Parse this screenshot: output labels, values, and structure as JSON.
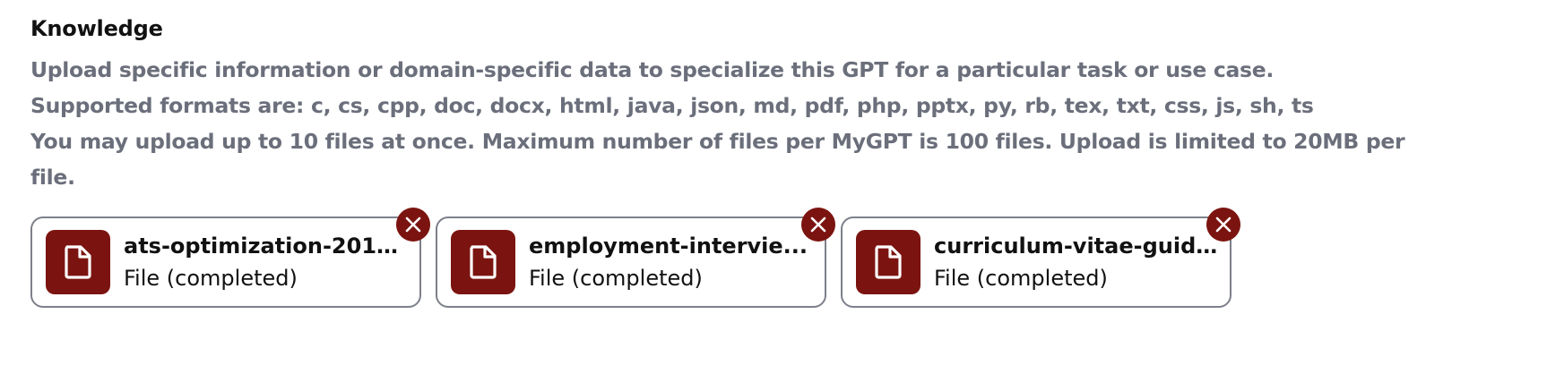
{
  "knowledge": {
    "title": "Knowledge",
    "description_lines": [
      "Upload specific information or domain-specific data to specialize this GPT for a particular task or use case.",
      "Supported formats are: c, cs, cpp, doc, docx, html, java, json, md, pdf, php, pptx, py, rb, tex, txt, css, js, sh, ts",
      "You may upload up to 10 files at once. Maximum number of files per MyGPT is 100 files. Upload is limited to 20MB per file."
    ],
    "files": [
      {
        "name": "ats-optimization-2015....",
        "status": "File (completed)",
        "icon": "document-icon",
        "remove_icon": "close-icon"
      },
      {
        "name": "employment-intervie...",
        "status": "File (completed)",
        "icon": "document-icon",
        "remove_icon": "close-icon"
      },
      {
        "name": "curriculum-vitae-guid...",
        "status": "File (completed)",
        "icon": "document-icon",
        "remove_icon": "close-icon"
      }
    ]
  },
  "colors": {
    "accent": "#7b1410",
    "muted_text": "#6b6f7b",
    "card_border": "#7d808a",
    "primary_text": "#111111"
  }
}
